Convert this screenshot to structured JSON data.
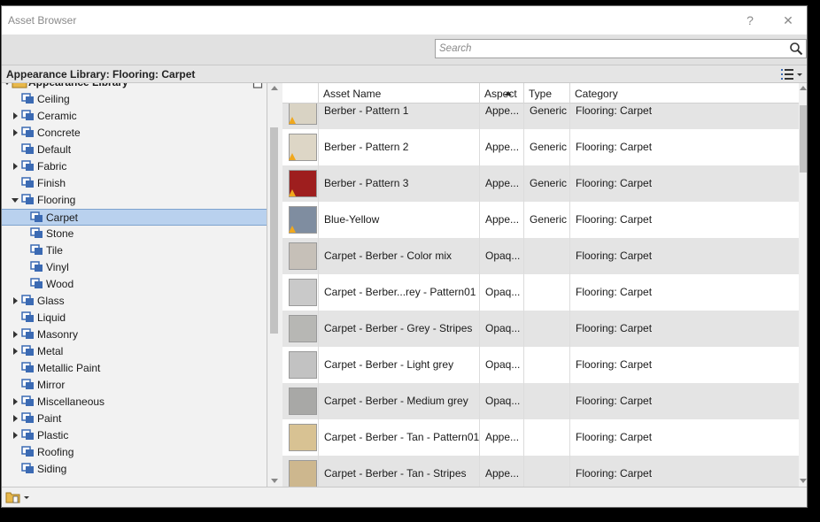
{
  "window": {
    "title": "Asset Browser",
    "help_label": "?",
    "close_label": "✕"
  },
  "search": {
    "placeholder": "Search",
    "value": ""
  },
  "path_bar": {
    "title": "Appearance Library: Flooring: Carpet"
  },
  "colors": {
    "selection": "#b9d1ee",
    "row_shade": "#e4e4e4",
    "warning": "#f0a81e",
    "folder": "#e8b84a",
    "library_icon": "#3b6ab3"
  },
  "tree": {
    "root": {
      "label": "Appearance Library",
      "expanded": true,
      "locked": true
    },
    "items": [
      {
        "label": "Ceiling",
        "level": 1,
        "expander": "none"
      },
      {
        "label": "Ceramic",
        "level": 1,
        "expander": "collapsed"
      },
      {
        "label": "Concrete",
        "level": 1,
        "expander": "collapsed"
      },
      {
        "label": "Default",
        "level": 1,
        "expander": "none"
      },
      {
        "label": "Fabric",
        "level": 1,
        "expander": "collapsed"
      },
      {
        "label": "Finish",
        "level": 1,
        "expander": "none"
      },
      {
        "label": "Flooring",
        "level": 1,
        "expander": "expanded"
      },
      {
        "label": "Carpet",
        "level": 2,
        "expander": "none",
        "selected": true
      },
      {
        "label": "Stone",
        "level": 2,
        "expander": "none"
      },
      {
        "label": "Tile",
        "level": 2,
        "expander": "none"
      },
      {
        "label": "Vinyl",
        "level": 2,
        "expander": "none"
      },
      {
        "label": "Wood",
        "level": 2,
        "expander": "none"
      },
      {
        "label": "Glass",
        "level": 1,
        "expander": "collapsed"
      },
      {
        "label": "Liquid",
        "level": 1,
        "expander": "none"
      },
      {
        "label": "Masonry",
        "level": 1,
        "expander": "collapsed"
      },
      {
        "label": "Metal",
        "level": 1,
        "expander": "collapsed"
      },
      {
        "label": "Metallic Paint",
        "level": 1,
        "expander": "none"
      },
      {
        "label": "Mirror",
        "level": 1,
        "expander": "none"
      },
      {
        "label": "Miscellaneous",
        "level": 1,
        "expander": "collapsed"
      },
      {
        "label": "Paint",
        "level": 1,
        "expander": "collapsed"
      },
      {
        "label": "Plastic",
        "level": 1,
        "expander": "collapsed"
      },
      {
        "label": "Roofing",
        "level": 1,
        "expander": "none"
      },
      {
        "label": "Siding",
        "level": 1,
        "expander": "none"
      }
    ]
  },
  "grid": {
    "columns": {
      "name": "Asset Name",
      "aspect": "Aspect",
      "type": "Type",
      "category": "Category"
    },
    "sort_column": "Asset Name",
    "sort_direction": "ascending",
    "rows": [
      {
        "name": "Berber - Pattern 1",
        "aspect": "Appe...",
        "type": "Generic",
        "category": "Flooring: Carpet",
        "swatch": "#d9d3c4",
        "warning": true,
        "shaded": true
      },
      {
        "name": "Berber - Pattern 2",
        "aspect": "Appe...",
        "type": "Generic",
        "category": "Flooring: Carpet",
        "swatch": "#ddd6c6",
        "warning": true,
        "shaded": false
      },
      {
        "name": "Berber - Pattern 3",
        "aspect": "Appe...",
        "type": "Generic",
        "category": "Flooring: Carpet",
        "swatch": "#9e1e1e",
        "warning": true,
        "shaded": true
      },
      {
        "name": "Blue-Yellow",
        "aspect": "Appe...",
        "type": "Generic",
        "category": "Flooring: Carpet",
        "swatch": "#7f8da0",
        "warning": true,
        "shaded": false
      },
      {
        "name": "Carpet - Berber - Color mix",
        "aspect": "Opaq...",
        "type": "",
        "category": "Flooring: Carpet",
        "swatch": "#c6c0b8",
        "warning": false,
        "shaded": true
      },
      {
        "name": "Carpet - Berber...rey - Pattern01",
        "aspect": "Opaq...",
        "type": "",
        "category": "Flooring: Carpet",
        "swatch": "#c9c9c9",
        "warning": false,
        "shaded": false
      },
      {
        "name": "Carpet - Berber - Grey - Stripes",
        "aspect": "Opaq...",
        "type": "",
        "category": "Flooring: Carpet",
        "swatch": "#b7b7b4",
        "warning": false,
        "shaded": true
      },
      {
        "name": "Carpet - Berber - Light grey",
        "aspect": "Opaq...",
        "type": "",
        "category": "Flooring: Carpet",
        "swatch": "#c2c2c2",
        "warning": false,
        "shaded": false
      },
      {
        "name": "Carpet - Berber - Medium grey",
        "aspect": "Opaq...",
        "type": "",
        "category": "Flooring: Carpet",
        "swatch": "#a8a8a6",
        "warning": false,
        "shaded": true
      },
      {
        "name": "Carpet - Berber - Tan - Pattern01",
        "aspect": "Appe...",
        "type": "",
        "category": "Flooring: Carpet",
        "swatch": "#d8c293",
        "warning": false,
        "shaded": false
      },
      {
        "name": "Carpet - Berber - Tan - Stripes",
        "aspect": "Appe...",
        "type": "",
        "category": "Flooring: Carpet",
        "swatch": "#cdb78e",
        "warning": false,
        "shaded": true
      }
    ]
  }
}
